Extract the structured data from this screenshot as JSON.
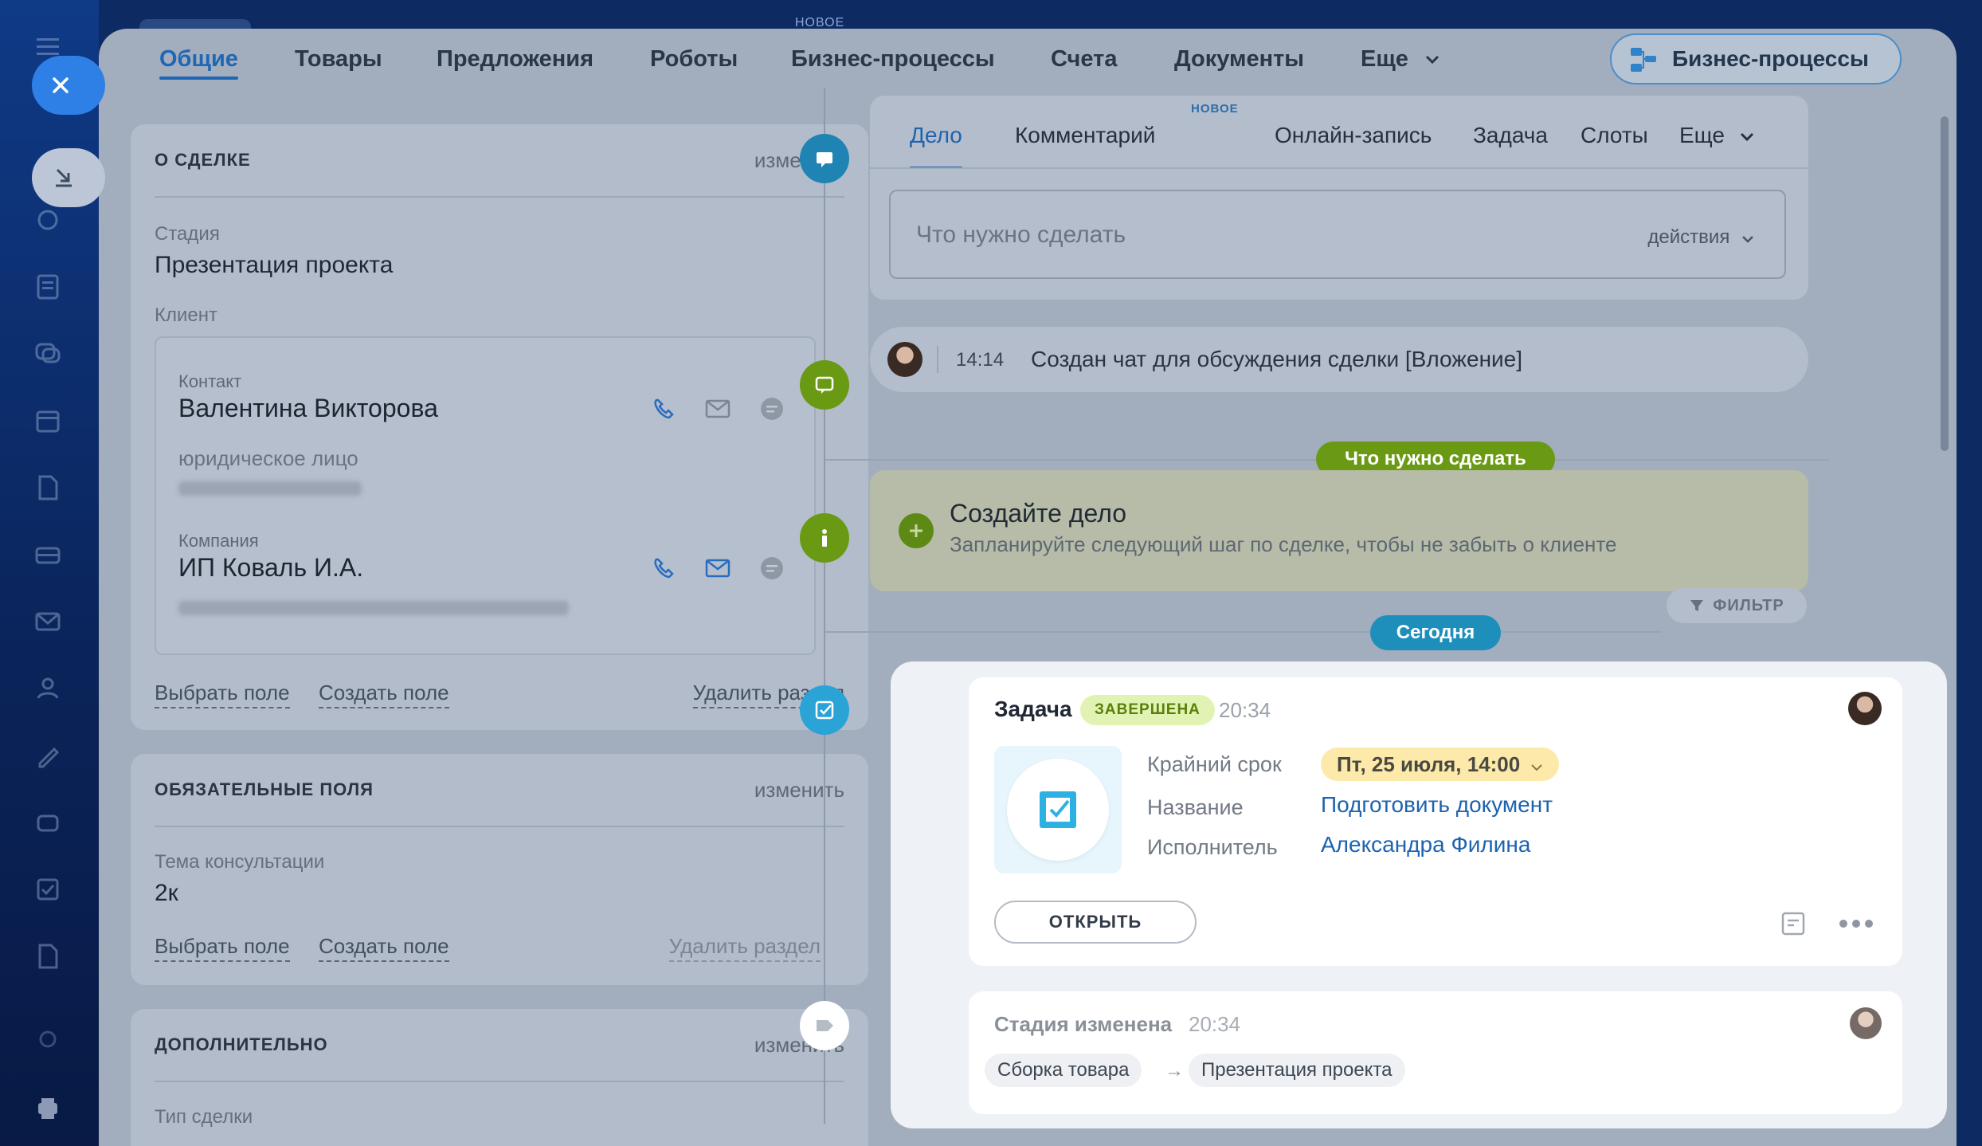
{
  "top": {
    "new_label": "НОВОЕ"
  },
  "tabs": [
    {
      "label": "Общие"
    },
    {
      "label": "Товары"
    },
    {
      "label": "Предложения"
    },
    {
      "label": "Роботы"
    },
    {
      "label": "Бизнес-процессы"
    },
    {
      "label": "Счета"
    },
    {
      "label": "Документы"
    },
    {
      "label": "Еще"
    }
  ],
  "bp_button": "Бизнес-процессы",
  "about": {
    "title": "О СДЕЛКЕ",
    "edit": "изменить",
    "stage_label": "Стадия",
    "stage_value": "Презентация проекта",
    "client_label": "Клиент",
    "contact_label": "Контакт",
    "contact_name": "Валентина Викторова",
    "contact_type": "юридическое лицо",
    "company_label": "Компания",
    "company_name": "ИП Коваль И.А.",
    "pick_field": "Выбрать поле",
    "create_field": "Создать поле",
    "delete_section": "Удалить раздел"
  },
  "required": {
    "title": "ОБЯЗАТЕЛЬНЫЕ ПОЛЯ",
    "edit": "изменить",
    "topic_label": "Тема консультации",
    "topic_value": "2к",
    "pick_field": "Выбрать поле",
    "create_field": "Создать поле",
    "delete_section": "Удалить раздел"
  },
  "extra": {
    "title": "ДОПОЛНИТЕЛЬНО",
    "edit": "изменить",
    "type_label": "Тип сделки"
  },
  "editor": {
    "tabs": [
      "Дело",
      "Комментарий",
      "Онлайн-запись",
      "Задача",
      "Слоты",
      "Еще"
    ],
    "new_label": "НОВОЕ",
    "placeholder": "Что нужно сделать",
    "actions": "действия"
  },
  "chat": {
    "time": "14:14",
    "text": "Создан чат для обсуждения сделки [Вложение]"
  },
  "todo_pill": "Что нужно сделать",
  "todo": {
    "title": "Создайте дело",
    "subtitle": "Запланируйте следующий шаг по сделке, чтобы не забыть о клиенте"
  },
  "today_pill": "Сегодня",
  "filter": "ФИЛЬТР",
  "task": {
    "title": "Задача",
    "badge": "ЗАВЕРШЕНА",
    "time": "20:34",
    "deadline_label": "Крайний срок",
    "deadline_value": "Пт, 25 июля, 14:00",
    "name_label": "Название",
    "name_value": "Подготовить документ",
    "assignee_label": "Исполнитель",
    "assignee_value": "Александра Филина",
    "open_button": "ОТКРЫТЬ"
  },
  "stage": {
    "title": "Стадия изменена",
    "time": "20:34",
    "from": "Сборка товара",
    "arrow": "→",
    "to": "Презентация проекта"
  },
  "colors": {
    "accent": "#1f66b5",
    "green": "#6a9a14",
    "teal": "#1e9dc7",
    "success_badge": "#e1f3b3",
    "deadline": "#fde9a9"
  }
}
